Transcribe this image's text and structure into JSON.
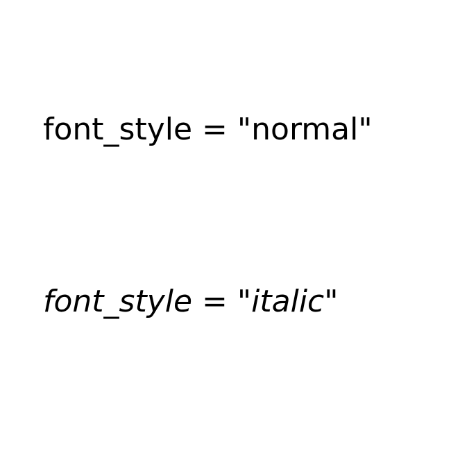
{
  "lines": [
    {
      "name_part": "font_style",
      "equals": " = ",
      "open_quote": "\"",
      "value": "normal",
      "close_quote": "\""
    },
    {
      "name_part": "font_style",
      "equals": " = ",
      "open_quote": "\"",
      "value": "italic",
      "close_quote": "\""
    }
  ],
  "colors": {
    "background": "#ffffff",
    "text": "#000000"
  }
}
